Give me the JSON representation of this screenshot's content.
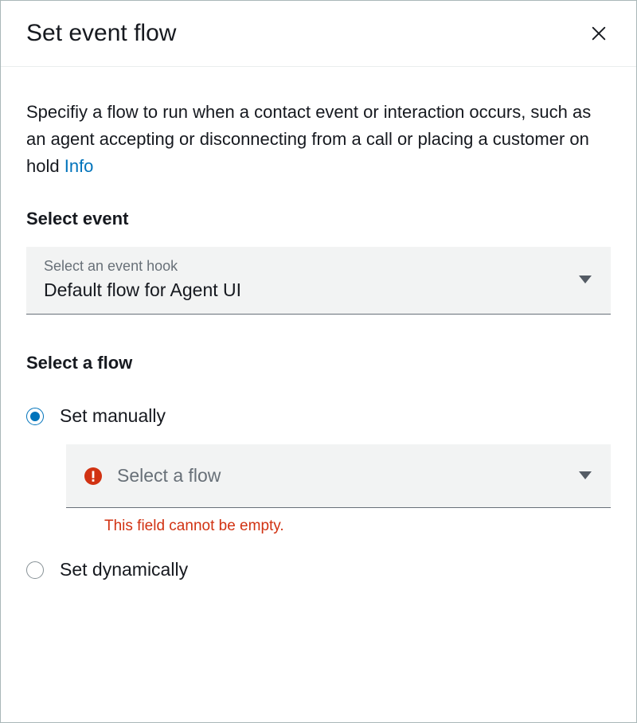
{
  "header": {
    "title": "Set event flow"
  },
  "body": {
    "description_text": "Specifiy a flow to run when a contact event or interaction occurs, such as an agent accepting or disconnecting from a call or placing a customer on hold ",
    "info_link": "Info"
  },
  "select_event": {
    "label": "Select event",
    "dropdown_caption": "Select an event hook",
    "dropdown_value": "Default flow for Agent UI"
  },
  "select_flow": {
    "label": "Select a flow",
    "options": {
      "manual": "Set manually",
      "dynamic": "Set dynamically"
    },
    "flow_dropdown_placeholder": "Select a flow",
    "error_message": "This field cannot be empty."
  }
}
